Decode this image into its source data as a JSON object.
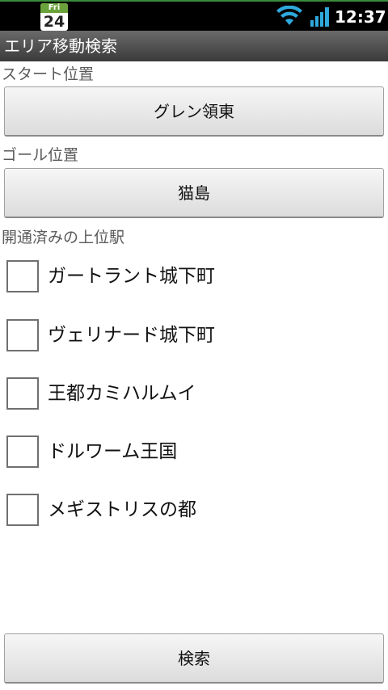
{
  "status_bar": {
    "calendar_day": "Fri",
    "calendar_date": "24",
    "time": "12:37",
    "wifi_icon": "wifi-icon",
    "signal_icon": "signal-icon"
  },
  "title_bar": {
    "title": "エリア移動検索"
  },
  "start": {
    "label": "スタート位置",
    "value": "グレン領東"
  },
  "goal": {
    "label": "ゴール位置",
    "value": "猫島"
  },
  "stations": {
    "label": "開通済みの上位駅",
    "items": [
      {
        "label": "ガートラント城下町",
        "checked": false
      },
      {
        "label": "ヴェリナード城下町",
        "checked": false
      },
      {
        "label": "王都カミハルムイ",
        "checked": false
      },
      {
        "label": "ドルワーム王国",
        "checked": false
      },
      {
        "label": "メギストリスの都",
        "checked": false
      }
    ]
  },
  "search_button": {
    "label": "検索"
  },
  "colors": {
    "status_bar_bg": "#000000",
    "title_bar_bg": "#4a4a4a",
    "wifi": "#2fa8dc",
    "signal": "#2fa8dc"
  }
}
